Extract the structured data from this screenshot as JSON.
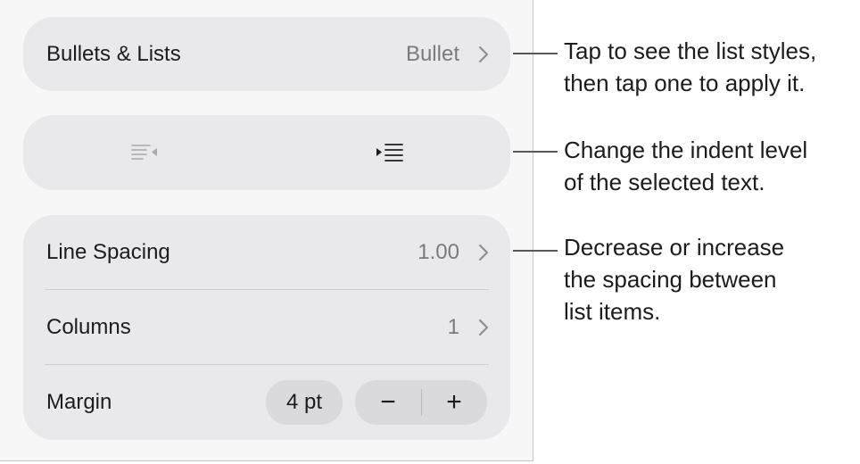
{
  "bullets_lists": {
    "label": "Bullets & Lists",
    "value": "Bullet"
  },
  "indent": {
    "decrease_icon": "decrease-indent-icon",
    "increase_icon": "increase-indent-icon"
  },
  "line_spacing": {
    "label": "Line Spacing",
    "value": "1.00"
  },
  "columns": {
    "label": "Columns",
    "value": "1"
  },
  "margin": {
    "label": "Margin",
    "value": "4 pt",
    "decrease_label": "−",
    "increase_label": "+"
  },
  "callouts": {
    "bullets": {
      "line1": "Tap to see the list styles,",
      "line2": "then tap one to apply it."
    },
    "indent": {
      "line1": "Change the indent level",
      "line2": "of the selected text."
    },
    "spacing": {
      "line1": "Decrease or increase",
      "line2": "the spacing between",
      "line3": "list items."
    }
  },
  "colors": {
    "panel_bg": "#f7f7f8",
    "card_bg": "#e9e9eb",
    "secondary_text": "#7a7a7e",
    "callout_line": "#58585c"
  }
}
